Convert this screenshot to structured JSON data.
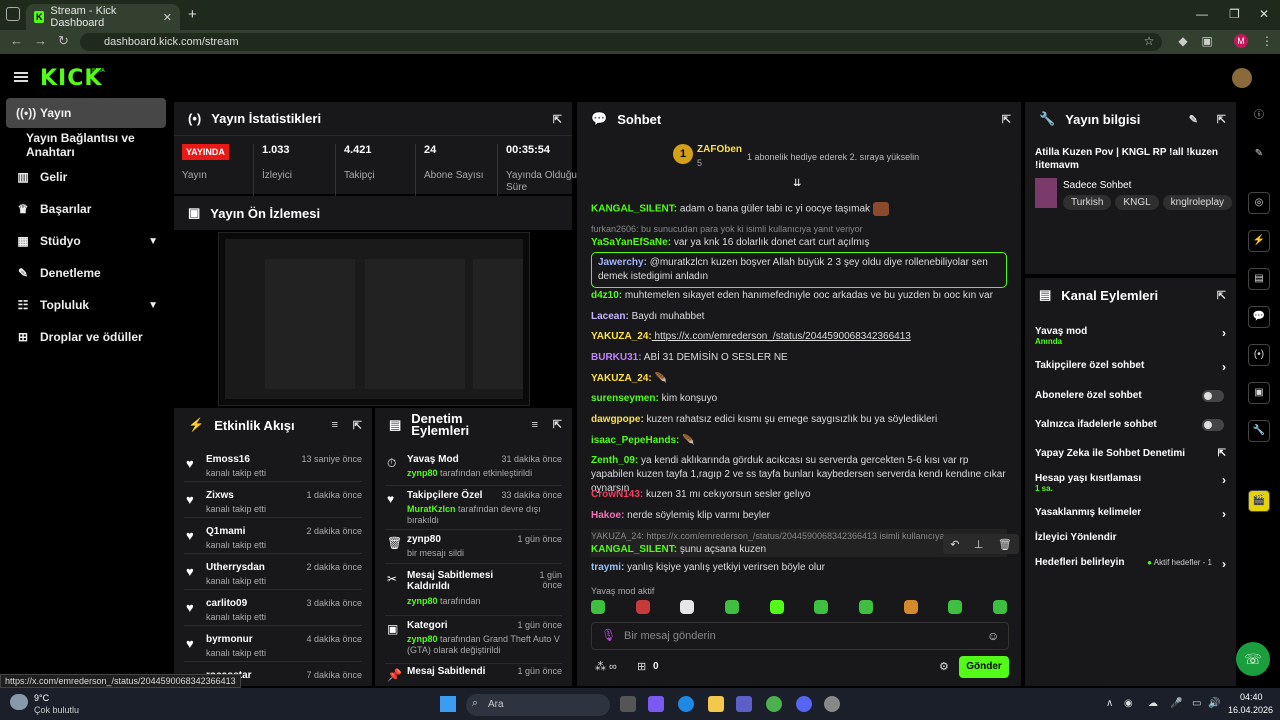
{
  "browser": {
    "tab_title": "Stream - Kick Dashboard",
    "url": "dashboard.kick.com/stream",
    "profile_initial": "M"
  },
  "logo": "KICK",
  "logo_badge": "BETA",
  "sidebar": {
    "items": [
      {
        "label": "Yayın",
        "icon": "broadcast-icon"
      },
      {
        "label": "Yayın Bağlantısı ve Anahtarı",
        "icon": ""
      },
      {
        "label": "Gelir",
        "icon": "chart-icon"
      },
      {
        "label": "Başarılar",
        "icon": "trophy-icon"
      },
      {
        "label": "Stüdyo",
        "icon": "studio-icon"
      },
      {
        "label": "Denetleme",
        "icon": "wrench-icon"
      },
      {
        "label": "Topluluk",
        "icon": "community-icon"
      },
      {
        "label": "Droplar ve ödüller",
        "icon": "gift-icon"
      }
    ]
  },
  "stats": {
    "title": "Yayın İstatistikleri",
    "live_badge": "YAYINDA",
    "live_label": "Yayın",
    "items": [
      {
        "value": "1.033",
        "label": "İzleyici"
      },
      {
        "value": "4.421",
        "label": "Takipçi"
      },
      {
        "value": "24",
        "label": "Abone Sayısı"
      },
      {
        "value": "00:35:54",
        "label": "Yayında Olduğu Süre"
      }
    ]
  },
  "preview": {
    "title": "Yayın Ön İzlemesi"
  },
  "activity": {
    "title": "Etkinlik Akışı",
    "items": [
      {
        "name": "Emoss16",
        "sub": "kanalı takip etti",
        "time": "13 saniye önce"
      },
      {
        "name": "Zixws",
        "sub": "kanalı takip etti",
        "time": "1 dakika önce"
      },
      {
        "name": "Q1mami",
        "sub": "kanalı takip etti",
        "time": "2 dakika önce"
      },
      {
        "name": "Utherrysdan",
        "sub": "kanalı takip etti",
        "time": "2 dakika önce"
      },
      {
        "name": "carlito09",
        "sub": "kanalı takip etti",
        "time": "3 dakika önce"
      },
      {
        "name": "byrmonur",
        "sub": "kanalı takip etti",
        "time": "4 dakika önce"
      },
      {
        "name": "roccostar",
        "sub": "",
        "time": "7 dakika önce"
      }
    ]
  },
  "mod_actions": {
    "title": "Denetim Eylemleri",
    "items": [
      {
        "name": "Yavaş Mod",
        "time": "31 dakika önce",
        "user": "zynp80",
        "desc": " tarafından etkinleştirildi"
      },
      {
        "name": "Takipçilere Özel",
        "time": "33 dakika önce",
        "user": "MuratKzlcn",
        "desc": " tarafından devre dışı bırakıldı"
      },
      {
        "name": "zynp80",
        "time": "1 gün önce",
        "user": "",
        "desc": "bir mesajı sildi"
      },
      {
        "name": "Mesaj Sabitlemesi Kaldırıldı",
        "time": "1 gün önce",
        "user": "zynp80",
        "desc": " tarafından"
      },
      {
        "name": "Kategori",
        "time": "1 gün önce",
        "user": "zynp80",
        "desc": " tarafından Grand Theft Auto V (GTA) olarak değiştirildi"
      },
      {
        "name": "Mesaj Sabitlendi",
        "time": "1 gün önce",
        "user": "",
        "desc": ""
      }
    ]
  },
  "chat": {
    "title": "Sohbet",
    "top_gifter": "ZAFOben",
    "top_gifter_count": "5",
    "gift_notice": "1 abonelik hediye ederek 2. sıraya yükselin",
    "messages": [
      {
        "user": "KANGAL_SILENT:",
        "color": "#53fc18",
        "text": " adam o bana güler tabi ıc yi oocye taşımak"
      },
      {
        "reply": "furkan2606: bu sunucudan para yok ki isimli kullanıcıya yanıt veriyor",
        "user": "YaSaYanEfSaNe:",
        "color": "#53fc18",
        "text": " var ya knk 16 dolarlık donet cart curt açılmış"
      },
      {
        "user": "Jawerchy:",
        "color": "#a5b4fc",
        "text": " @muratkzlcn kuzen boşver Allah büyük 2 3 şey oldu diye rollenebiliyolar sen demek istedigimi anladın"
      },
      {
        "user": "d4z10:",
        "color": "#53fc18",
        "text": " muhtemelen sıkayet eden hanımefednıyle ooc arkadas ve bu yuzden bı ooc kın var"
      },
      {
        "user": "Lacean:",
        "color": "#c4b5fd",
        "text": " Baydı muhabbet"
      },
      {
        "user": "YAKUZA_24:",
        "color": "#fde047",
        "text": " https://x.com/emrederson_/status/2044590068342366413"
      },
      {
        "user": "BURKU31:",
        "color": "#c084fc",
        "text": " ABİ 31 DEMİSİN O SESLER NE"
      },
      {
        "user": "YAKUZA_24:",
        "color": "#fde047",
        "text": ""
      },
      {
        "user": "surenseymen:",
        "color": "#53fc18",
        "text": " kim konşuyo"
      },
      {
        "user": "dawgpope:",
        "color": "#fde047",
        "text": " kuzen rahatsız edici kısmı şu emege saygısızlık bu ya söyledikleri"
      },
      {
        "user": "isaac_PepeHands:",
        "color": "#53fc18",
        "text": ""
      },
      {
        "user": "Zenth_09:",
        "color": "#53fc18",
        "text": " ya kendi aklıkarında görduk acıkcası su serverda gercekten 5-6 kısı var rp yapabilen kuzen tayfa 1,ragıp 2 ve ss tayfa bunları kaybedersen serverda kendı kendıne cıkar oynarsın"
      },
      {
        "user": "CrowN143:",
        "color": "#f43f5e",
        "text": " kuzen 31 mı cekıyorsun sesler gelıyo"
      },
      {
        "user": "Hakoe:",
        "color": "#f472b6",
        "text": " nerde söylemiş klip varmı beyler"
      },
      {
        "reply": "YAKUZA_24: https://x.com/emrederson_/status/2044590068342366413 isimli kullanıcıya",
        "user": "KANGAL_SILENT:",
        "color": "#53fc18",
        "text": " şunu açsana kuzen"
      },
      {
        "user": "traymi:",
        "color": "#93c5fd",
        "text": " yanlış kişiye yanlış yetkiyi verirsen böyle olur"
      }
    ],
    "slow_mode": "Yavaş mod aktif",
    "input_placeholder": "Bir mesaj gönderin",
    "points": "0",
    "send": "Gönder"
  },
  "stream_info": {
    "title": "Yayın bilgisi",
    "stream_title": "Atilla Kuzen Pov | KNGL RP !all !kuzen !itemavm",
    "category": "Sadece Sohbet",
    "tags": [
      "Turkish",
      "KNGL",
      "knglroleplay"
    ]
  },
  "channel_actions": {
    "title": "Kanal Eylemleri",
    "items": [
      {
        "label": "Yavaş mod",
        "sub": "Anında",
        "kind": "chevron"
      },
      {
        "label": "Takipçilere özel sohbet",
        "sub": "",
        "kind": "chevron"
      },
      {
        "label": "Abonelere özel sohbet",
        "sub": "",
        "kind": "toggle"
      },
      {
        "label": "Yalnızca ifadelerle sohbet",
        "sub": "",
        "kind": "toggle"
      },
      {
        "label": "Yapay Zeka ile Sohbet Denetimi",
        "sub": "",
        "kind": "external"
      },
      {
        "label": "Hesap yaşı kısıtlaması",
        "sub": "1 sa.",
        "kind": "chevron"
      },
      {
        "label": "Yasaklanmış kelimeler",
        "sub": "",
        "kind": "chevron"
      },
      {
        "label": "İzleyici Yönlendir",
        "sub": "",
        "kind": "none"
      },
      {
        "label": "Hedefleri belirleyin",
        "sub": "",
        "kind": "chevron",
        "extra": "Aktif hedefler - 1"
      }
    ]
  },
  "status_url": "https://x.com/emrederson_/status/2044590068342366413",
  "taskbar": {
    "weather_temp": "9°C",
    "weather_desc": "Çok bulutlu",
    "search": "Ara",
    "time": "04:40",
    "date": "16.04.2026"
  },
  "colors": {
    "accent": "#53fc18",
    "panel": "#18181b",
    "live": "#e91916"
  }
}
